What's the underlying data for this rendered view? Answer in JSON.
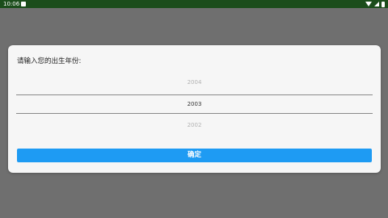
{
  "status_bar": {
    "time": "10:06",
    "icons": [
      "notification-icon",
      "wifi-icon",
      "signal-icon",
      "battery-icon"
    ]
  },
  "dialog": {
    "prompt": "请输入您的出生年份:",
    "picker": {
      "above": "2004",
      "selected": "2003",
      "below": "2002"
    },
    "confirm_label": "确定"
  },
  "colors": {
    "status_bar": "#1b4d1b",
    "backdrop": "#6f6f6f",
    "dialog_bg": "#f6f6f6",
    "accent": "#1e9bf3"
  }
}
